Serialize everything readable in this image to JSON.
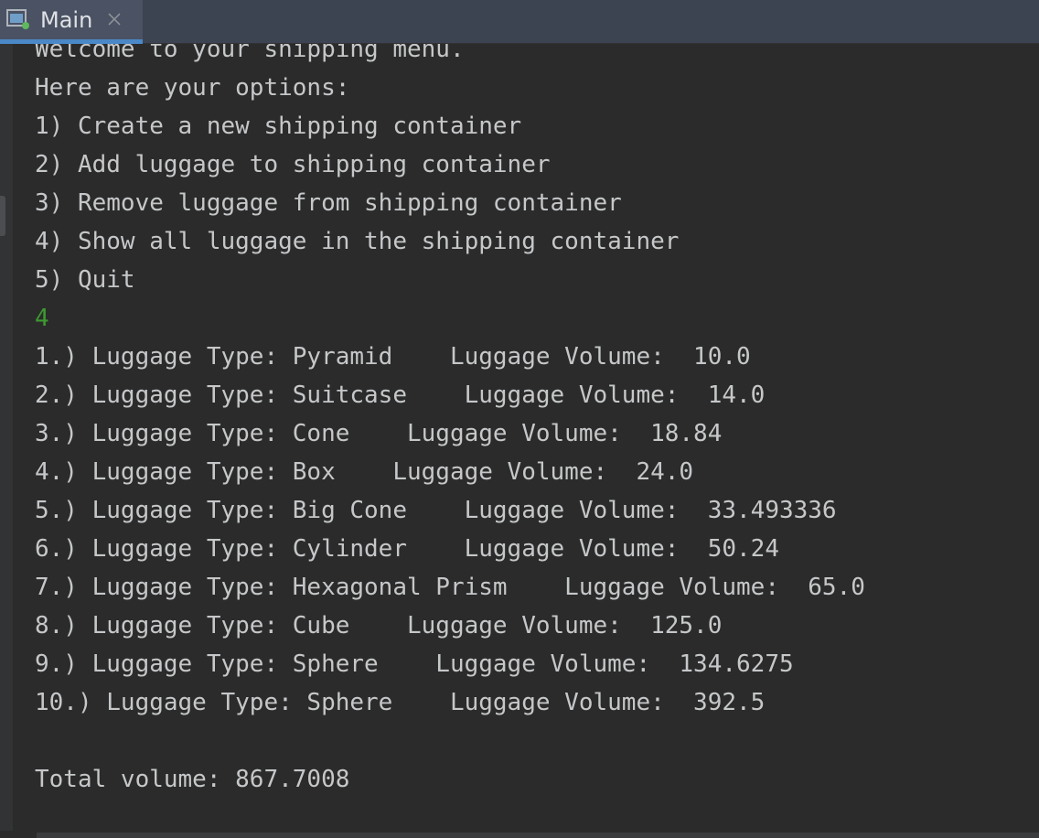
{
  "tab": {
    "label": "Main",
    "icon": "console-app-icon",
    "running_indicator_color": "#5fb85f",
    "accent": "#4a88c7"
  },
  "console": {
    "lines": [
      {
        "text": "Welcome to your shipping menu.",
        "kind": "output"
      },
      {
        "text": "Here are your options:",
        "kind": "output"
      },
      {
        "text": "1) Create a new shipping container",
        "kind": "output"
      },
      {
        "text": "2) Add luggage to shipping container",
        "kind": "output"
      },
      {
        "text": "3) Remove luggage from shipping container",
        "kind": "output"
      },
      {
        "text": "4) Show all luggage in the shipping container",
        "kind": "output"
      },
      {
        "text": "5) Quit",
        "kind": "output"
      },
      {
        "text": "4",
        "kind": "input"
      },
      {
        "text": "1.) Luggage Type: Pyramid    Luggage Volume:  10.0",
        "kind": "output"
      },
      {
        "text": "2.) Luggage Type: Suitcase    Luggage Volume:  14.0",
        "kind": "output"
      },
      {
        "text": "3.) Luggage Type: Cone    Luggage Volume:  18.84",
        "kind": "output"
      },
      {
        "text": "4.) Luggage Type: Box    Luggage Volume:  24.0",
        "kind": "output"
      },
      {
        "text": "5.) Luggage Type: Big Cone    Luggage Volume:  33.493336",
        "kind": "output"
      },
      {
        "text": "6.) Luggage Type: Cylinder    Luggage Volume:  50.24",
        "kind": "output"
      },
      {
        "text": "7.) Luggage Type: Hexagonal Prism    Luggage Volume:  65.0",
        "kind": "output"
      },
      {
        "text": "8.) Luggage Type: Cube    Luggage Volume:  125.0",
        "kind": "output"
      },
      {
        "text": "9.) Luggage Type: Sphere    Luggage Volume:  134.6275",
        "kind": "output"
      },
      {
        "text": "10.) Luggage Type: Sphere    Luggage Volume:  392.5",
        "kind": "output"
      },
      {
        "text": "",
        "kind": "output"
      },
      {
        "text": "Total volume: 867.7008",
        "kind": "output"
      }
    ],
    "output_color": "#c5c7c9",
    "input_color": "#3c9a2f"
  }
}
